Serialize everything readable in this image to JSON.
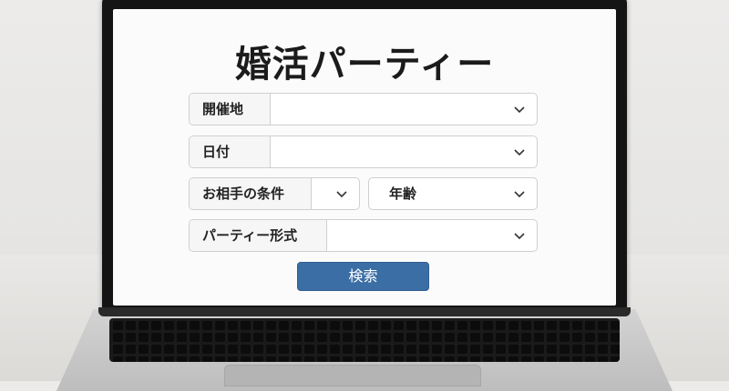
{
  "page_title": "婚活パーティー",
  "form": {
    "venue": {
      "label": "開催地",
      "value": ""
    },
    "date": {
      "label": "日付",
      "value": ""
    },
    "partner_conditions": {
      "label": "お相手の条件",
      "value": ""
    },
    "age": {
      "label": "年齢",
      "value": ""
    },
    "party_format": {
      "label": "パーティー形式",
      "value": ""
    }
  },
  "search_button": {
    "label": "検索"
  },
  "icons": {
    "dropdown": "chevron-down-icon"
  },
  "colors": {
    "button_bg": "#3a6ea5",
    "button_text": "#ffffff",
    "bezel": "#141414"
  }
}
